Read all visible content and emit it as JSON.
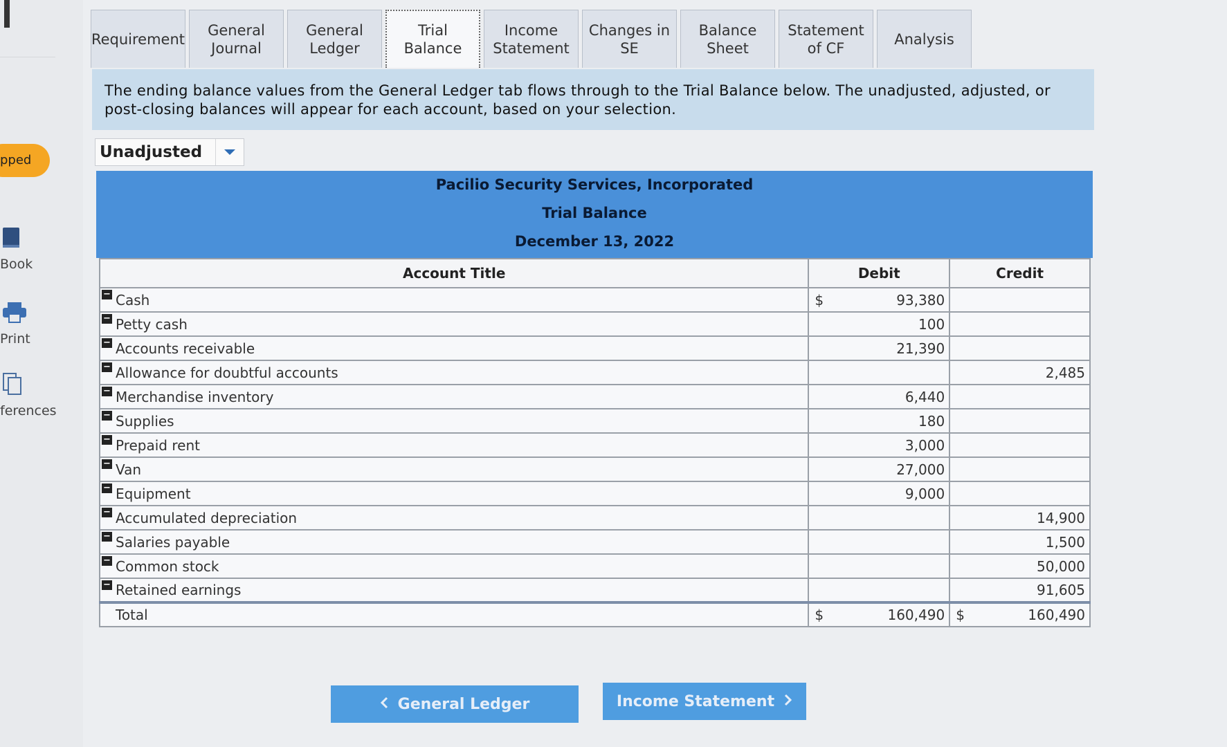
{
  "rail": {
    "skipped_label": "pped",
    "book_label": "Book",
    "print_label": "Print",
    "references_label": "ferences"
  },
  "tabs": [
    {
      "label": "Requirement"
    },
    {
      "label": "General Journal"
    },
    {
      "label": "General Ledger"
    },
    {
      "label": "Trial Balance",
      "active": true
    },
    {
      "label": "Income Statement"
    },
    {
      "label": "Changes in SE"
    },
    {
      "label": "Balance Sheet"
    },
    {
      "label": "Statement of CF"
    },
    {
      "label": "Analysis"
    }
  ],
  "info_text": "The ending balance values from the General Ledger tab flows through to the Trial Balance below. The unadjusted, adjusted, or post-closing balances will appear for each account, based on your selection.",
  "balance_type": {
    "selected": "Unadjusted"
  },
  "report": {
    "company": "Pacilio Security Services, Incorporated",
    "title": "Trial Balance",
    "date": "December 13, 2022"
  },
  "table": {
    "headers": {
      "account": "Account Title",
      "debit": "Debit",
      "credit": "Credit"
    },
    "currency_symbol": "$",
    "rows": [
      {
        "account": "Cash",
        "debit": "93,380",
        "credit": ""
      },
      {
        "account": "Petty cash",
        "debit": "100",
        "credit": ""
      },
      {
        "account": "Accounts receivable",
        "debit": "21,390",
        "credit": ""
      },
      {
        "account": "Allowance for doubtful accounts",
        "debit": "",
        "credit": "2,485"
      },
      {
        "account": "Merchandise inventory",
        "debit": "6,440",
        "credit": ""
      },
      {
        "account": "Supplies",
        "debit": "180",
        "credit": ""
      },
      {
        "account": "Prepaid rent",
        "debit": "3,000",
        "credit": ""
      },
      {
        "account": "Van",
        "debit": "27,000",
        "credit": ""
      },
      {
        "account": "Equipment",
        "debit": "9,000",
        "credit": ""
      },
      {
        "account": "Accumulated depreciation",
        "debit": "",
        "credit": "14,900"
      },
      {
        "account": "Salaries payable",
        "debit": "",
        "credit": "1,500"
      },
      {
        "account": "Common stock",
        "debit": "",
        "credit": "50,000"
      },
      {
        "account": "Retained earnings",
        "debit": "",
        "credit": "91,605"
      }
    ],
    "total": {
      "label": "Total",
      "debit": "160,490",
      "credit": "160,490"
    }
  },
  "nav": {
    "prev_label": "General Ledger",
    "next_label": "Income Statement"
  },
  "colors": {
    "band": "#4a90d9",
    "info_bg": "#c8dcec",
    "skipped_badge": "#f5a623",
    "nav_button": "#4f9de0"
  }
}
